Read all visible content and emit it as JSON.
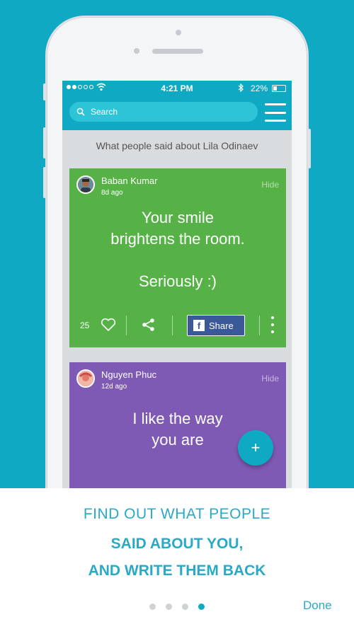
{
  "status": {
    "time": "4:21 PM",
    "battery": "22%"
  },
  "search": {
    "placeholder": "Search"
  },
  "section_title": "What people said about Lila Odinaev",
  "cards": [
    {
      "author": "Baban Kumar",
      "time": "8d ago",
      "hide_label": "Hide",
      "message": "Your smile\nbrightens the room.\n\nSeriously :)",
      "likes": "25",
      "share_label": "Share",
      "color": "#56b247"
    },
    {
      "author": "Nguyen Phuc",
      "time": "12d ago",
      "hide_label": "Hide",
      "message": "I like the way\nyou are",
      "color": "#7f5ab5"
    }
  ],
  "fab_label": "+",
  "onboarding": {
    "line1": "FIND OUT WHAT PEOPLE",
    "line2": "SAID ABOUT YOU,",
    "line3": "AND WRITE THEM BACK",
    "done_label": "Done",
    "pages": 4,
    "active_page": 4
  },
  "colors": {
    "accent": "#10a9c3",
    "text_accent": "#2aa9c6"
  },
  "icons": [
    "search-icon",
    "menu-icon",
    "heart-icon",
    "share-icon",
    "facebook-icon",
    "more-icon",
    "plus-icon",
    "wifi-icon",
    "bluetooth-icon",
    "battery-icon"
  ]
}
